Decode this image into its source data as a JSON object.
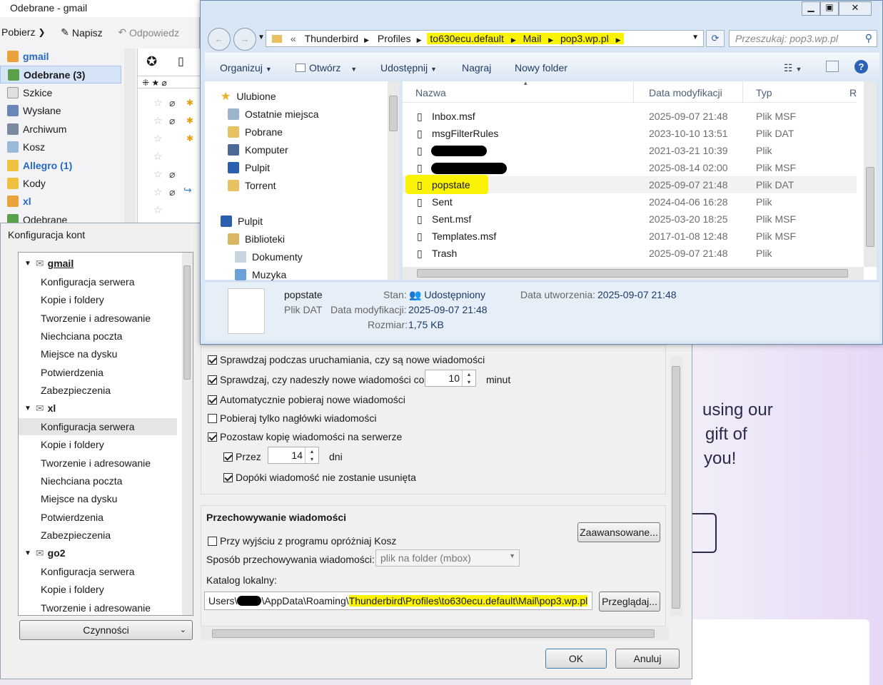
{
  "thunderbird": {
    "title": "Odebrane - gmail",
    "get_label": "Pobierz",
    "write_label": "Napisz",
    "reply_label": "Odpowiedz",
    "folders": [
      {
        "label": "gmail"
      },
      {
        "label": "Odebrane (3)"
      },
      {
        "label": "Szkice"
      },
      {
        "label": "Wysłane"
      },
      {
        "label": "Archiwum"
      },
      {
        "label": "Kosz"
      },
      {
        "label": "Allegro (1)"
      },
      {
        "label": "Kody"
      },
      {
        "label": "xl"
      },
      {
        "label": "Odebrane"
      }
    ]
  },
  "web": {
    "line1": "using our",
    "line2": "gift of",
    "line3": "you!"
  },
  "accounts": {
    "title": "Konfiguracja kont",
    "tree": [
      {
        "label": "gmail"
      },
      {
        "label": "Konfiguracja serwera"
      },
      {
        "label": "Kopie i foldery"
      },
      {
        "label": "Tworzenie i adresowanie"
      },
      {
        "label": "Niechciana poczta"
      },
      {
        "label": "Miejsce na dysku"
      },
      {
        "label": "Potwierdzenia"
      },
      {
        "label": "Zabezpieczenia"
      },
      {
        "label": "xl"
      },
      {
        "label": "Konfiguracja serwera"
      },
      {
        "label": "Kopie i foldery"
      },
      {
        "label": "Tworzenie i adresowanie"
      },
      {
        "label": "Niechciana poczta"
      },
      {
        "label": "Miejsce na dysku"
      },
      {
        "label": "Potwierdzenia"
      },
      {
        "label": "Zabezpieczenia"
      },
      {
        "label": "go2"
      },
      {
        "label": "Konfiguracja serwera"
      },
      {
        "label": "Kopie i foldery"
      },
      {
        "label": "Tworzenie i adresowanie"
      }
    ],
    "actions_label": "Czynności",
    "opts": {
      "check_startup": "Sprawdzaj podczas uruchamiania, czy są nowe wiadomości",
      "check_every": "Sprawdzaj, czy nadeszły nowe wiadomości co",
      "check_every_value": "10",
      "minutes": "minut",
      "auto_download": "Automatycznie pobieraj nowe wiadomości",
      "headers_only": "Pobieraj tylko nagłówki wiadomości",
      "leave_copy": "Pozostaw kopię wiadomości na serwerze",
      "for_label": "Przez",
      "for_value": "14",
      "days": "dni",
      "until_deleted": "Dopóki wiadomość nie zostanie usunięta"
    },
    "storage": {
      "heading": "Przechowywanie wiadomości",
      "empty_trash": "Przy wyjściu z programu opróżniaj Kosz",
      "advanced_btn": "Zaawansowane...",
      "storage_type_label": "Sposób przechowywania wiadomości:",
      "storage_type_value": "plik na folder (mbox)",
      "local_dir_label": "Katalog lokalny:",
      "path_prefix": "Users\\",
      "path_mid": "\\AppData\\Roaming\\",
      "path_hl": "Thunderbird\\Profiles\\to630ecu.default\\Mail\\pop3.wp.pl",
      "browse_btn": "Przeglądaj..."
    },
    "ok": "OK",
    "cancel": "Anuluj"
  },
  "explorer": {
    "breadcrumb": [
      "Thunderbird",
      "Profiles",
      "to630ecu.default",
      "Mail",
      "pop3.wp.pl"
    ],
    "search_placeholder": "Przeszukaj: pop3.wp.pl",
    "cmd": {
      "organize": "Organizuj",
      "open": "Otwórz",
      "share": "Udostępnij",
      "burn": "Nagraj",
      "new_folder": "Nowy folder"
    },
    "nav": [
      {
        "label": "Ulubione"
      },
      {
        "label": "Ostatnie miejsca"
      },
      {
        "label": "Pobrane"
      },
      {
        "label": "Komputer"
      },
      {
        "label": "Pulpit"
      },
      {
        "label": "Torrent"
      },
      {
        "label": "Pulpit"
      },
      {
        "label": "Biblioteki"
      },
      {
        "label": "Dokumenty"
      },
      {
        "label": "Muzyka"
      }
    ],
    "columns": {
      "name": "Nazwa",
      "date": "Data modyfikacji",
      "type": "Typ",
      "size": "R"
    },
    "files": [
      {
        "name": "Inbox.msf",
        "date": "2025-09-07 21:48",
        "type": "Plik MSF"
      },
      {
        "name": "msgFilterRules",
        "date": "2023-10-10 13:51",
        "type": "Plik DAT"
      },
      {
        "name": "",
        "date": "2021-03-21 10:39",
        "type": "Plik"
      },
      {
        "name": "",
        "date": "2025-08-14 02:00",
        "type": "Plik MSF"
      },
      {
        "name": "popstate",
        "date": "2025-09-07 21:48",
        "type": "Plik DAT"
      },
      {
        "name": "Sent",
        "date": "2024-04-06 16:28",
        "type": "Plik"
      },
      {
        "name": "Sent.msf",
        "date": "2025-03-20 18:25",
        "type": "Plik MSF"
      },
      {
        "name": "Templates.msf",
        "date": "2017-01-08 12:48",
        "type": "Plik MSF"
      },
      {
        "name": "Trash",
        "date": "2025-09-07 21:48",
        "type": "Plik"
      }
    ],
    "details": {
      "name": "popstate",
      "type": "Plik DAT",
      "state_label": "Stan:",
      "state_value": "Udostępniony",
      "created_label": "Data utworzenia:",
      "created_value": "2025-09-07 21:48",
      "modified_label": "Data modyfikacji:",
      "modified_value": "2025-09-07 21:48",
      "size_label": "Rozmiar:",
      "size_value": "1,75 KB"
    }
  }
}
